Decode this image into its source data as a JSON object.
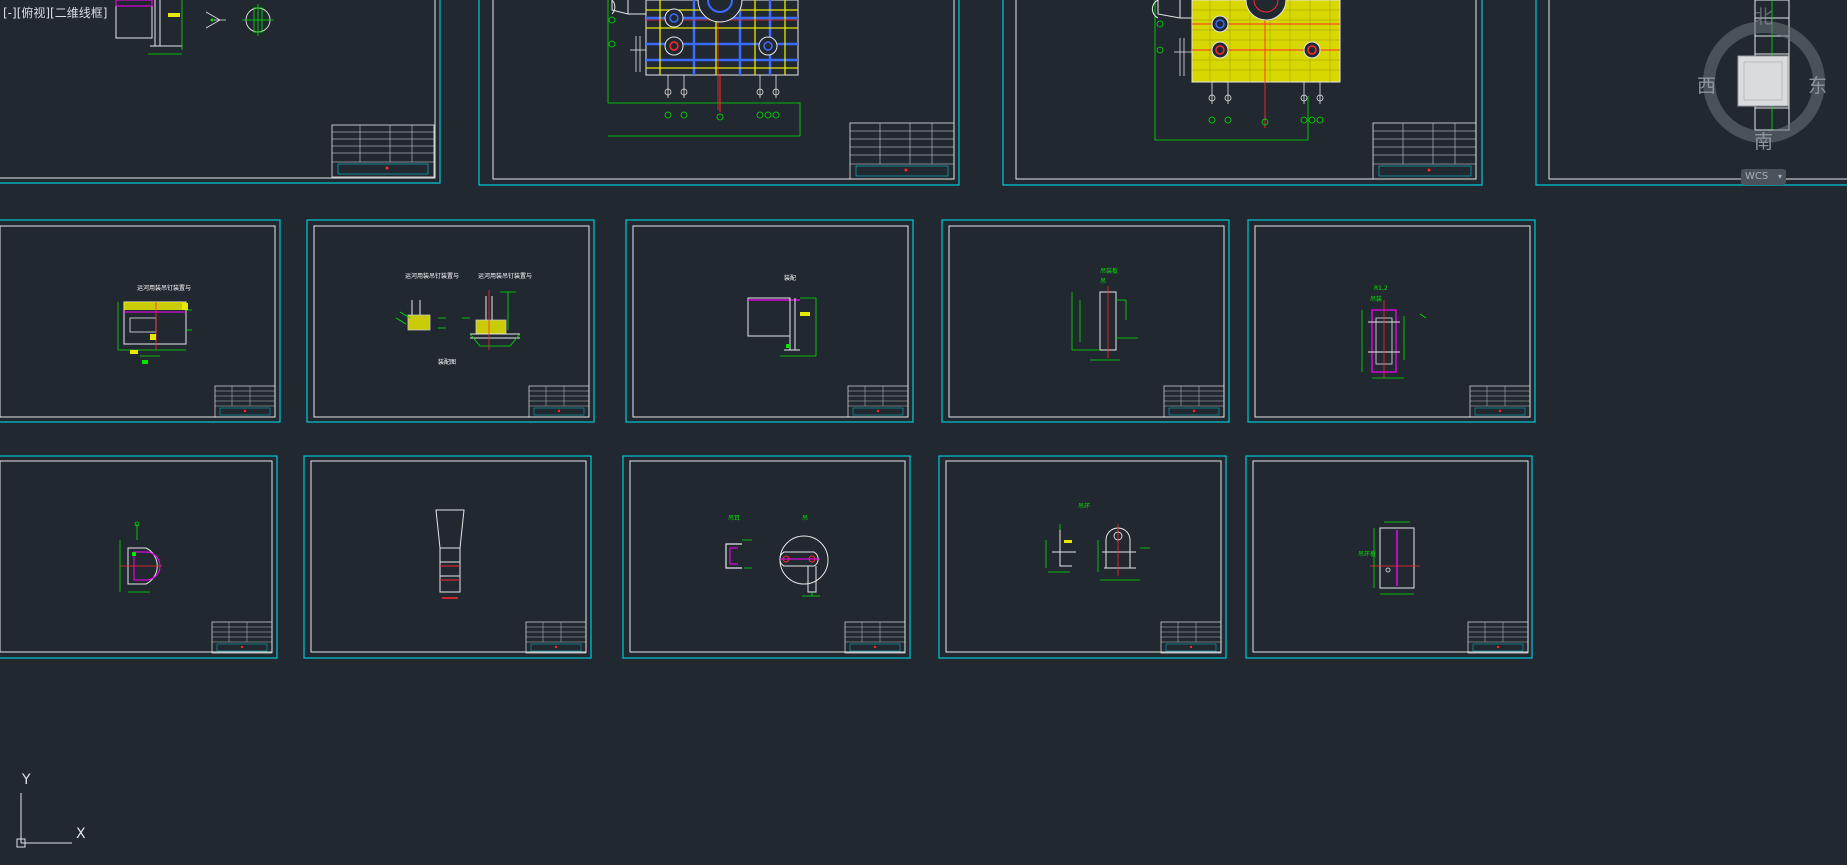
{
  "viewport": {
    "label": "[-][俯视][二维线框]"
  },
  "viewcube": {
    "north": "北",
    "south": "南",
    "east": "东",
    "west": "西",
    "wcs_label": "WCS",
    "wcs_menu_icon": "chevron-down-icon"
  },
  "ucs": {
    "x_label": "X",
    "y_label": "Y"
  },
  "colors": {
    "background": "#212830",
    "sheet_frame": "#00c8d8",
    "sheet_border": "#e6e6e6",
    "green": "#00e600",
    "yellow": "#e8e800",
    "red": "#ff2a2a",
    "magenta": "#ff00ff",
    "blue": "#3b6cff"
  },
  "sheets": {
    "row2": [
      {
        "title": "运河用装吊钉装置与"
      },
      {
        "title": "运河用装吊钉装置与",
        "subtitle": "运河用装吊钉装置与",
        "caption": "装配图"
      },
      {
        "title": "装配"
      },
      {
        "title": "吊装板",
        "subtitle": "吊"
      },
      {
        "title": "R1.2",
        "subtitle": "吊装"
      }
    ],
    "row3": [
      {
        "title": ""
      },
      {
        "title": ""
      },
      {
        "title": "吊耳",
        "subtitle": "吊"
      },
      {
        "title": "吊环"
      },
      {
        "title": "吊环板"
      }
    ]
  }
}
